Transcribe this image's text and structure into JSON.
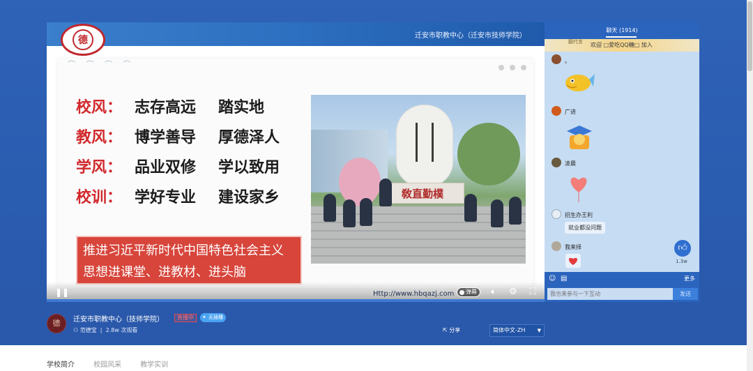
{
  "video": {
    "header_text": "迁安市职教中心（迁安市技师学院）",
    "logo_char": "德",
    "mottos": [
      {
        "key": "校风：",
        "v1": "志存高远",
        "v2": "踏实地"
      },
      {
        "key": "教风：",
        "v1": "博学善导",
        "v2": "厚德泽人"
      },
      {
        "key": "学风：",
        "v1": "品业双修",
        "v2": "学以致用"
      },
      {
        "key": "校训：",
        "v1": "学好专业",
        "v2": "建设家乡"
      }
    ],
    "banner_text": "推进习近平新时代中国特色社会主义思想进课堂、进教材、进头脑",
    "monument_text": "敎直勤樸",
    "url": "Http://www.hbqazj.com",
    "danmu_label": "弹幕"
  },
  "chat": {
    "title": "聊天 (1914)",
    "notice_prefix": "翻代言",
    "notice": "欢迎  □爱吃QQ糖□  加入",
    "messages": [
      {
        "name": "。",
        "type": "sticker",
        "sticker": "fish-sticker"
      },
      {
        "name": "广进",
        "type": "sticker",
        "sticker": "graduate-sticker"
      },
      {
        "name": "凌晨",
        "type": "sticker",
        "sticker": "heart-balloon-sticker"
      },
      {
        "name": "招生办王利",
        "type": "text",
        "text": "就业都没问题"
      },
      {
        "name": "我来择",
        "type": "sticker",
        "sticker": "heart-sticker"
      }
    ],
    "like_count": "1.3w",
    "more_label": "更多",
    "input_placeholder": "我也来参与一下互动",
    "send_label": "发送"
  },
  "channel": {
    "name": "迁安市职教中心（技师学院）",
    "live_badge": "直播中",
    "noad_badge": "无插播",
    "host": "范德宝",
    "views": "2.8w 次观看",
    "share_label": "分享",
    "language": "简体中文-ZH"
  },
  "tabs": [
    "学校简介",
    "校园风采",
    "教学实训"
  ]
}
